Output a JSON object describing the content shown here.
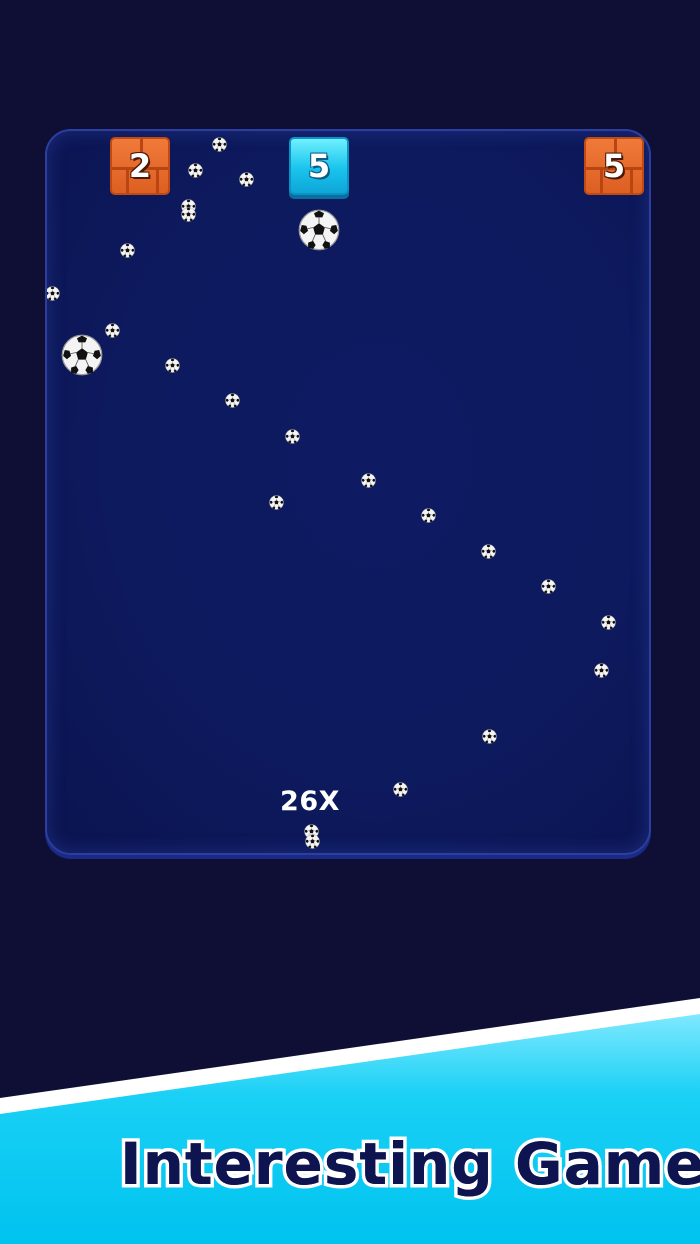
{
  "bricks": [
    {
      "value": "2",
      "style": "orange"
    },
    {
      "value": "5",
      "style": "cyan"
    },
    {
      "value": "5",
      "style": "orange"
    }
  ],
  "multiplier": "26X",
  "banner": {
    "title": "Interesting Game"
  },
  "colors": {
    "background": "#0f0e35",
    "arena": "#0d1a5e",
    "arena_border": "#2a3fa0",
    "brick_orange": "#e4652a",
    "brick_cyan": "#19c4ec",
    "banner_cyan": "#1ad0f5",
    "title_text": "#0e1450"
  },
  "icons": {
    "ball": "soccer-ball-icon"
  }
}
